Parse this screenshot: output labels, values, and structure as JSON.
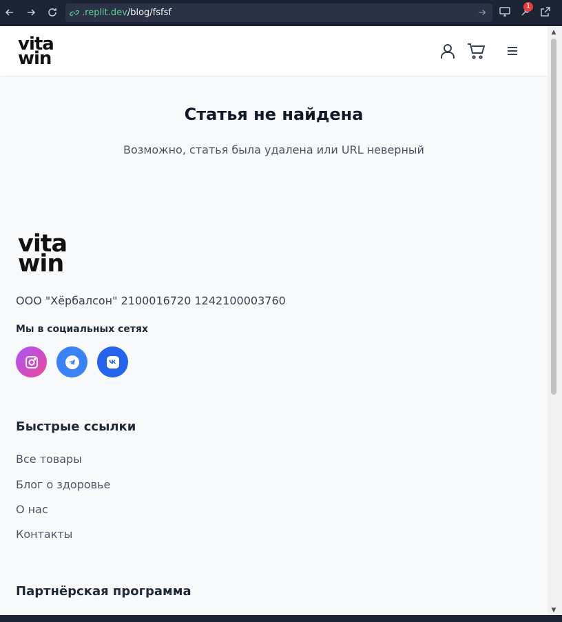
{
  "browser": {
    "url_host": ".replit.dev",
    "url_path": "/blog/fsfsf",
    "badge_count": "1"
  },
  "header": {
    "logo_line1": "vita",
    "logo_line2": "win",
    "icons": [
      "user-icon",
      "cart-icon",
      "menu-icon"
    ]
  },
  "main": {
    "title": "Статья не найдена",
    "message": "Возможно, статья была удалена или URL неверный"
  },
  "footer": {
    "logo_line1": "vita",
    "logo_line2": "win",
    "company": "ООО \"Хёрбалсон\" 2100016720 1242100003760",
    "social_title": "Мы в социальных сетях",
    "social": [
      "instagram-icon",
      "telegram-icon",
      "vk-icon"
    ],
    "quick_links_title": "Быстрые ссылки",
    "quick_links": [
      "Все товары",
      "Блог о здоровье",
      "О нас",
      "Контакты"
    ],
    "partner_title": "Партнёрская программа"
  },
  "colors": {
    "chrome_bg": "#1c2333",
    "page_bg": "#f8f9fb",
    "url_host": "#5ccf8f",
    "instagram_gradient": [
      "#a855f7",
      "#ec4899"
    ],
    "telegram": "#3b82f6",
    "vk": "#2563eb",
    "badge": "#e53e3e"
  }
}
